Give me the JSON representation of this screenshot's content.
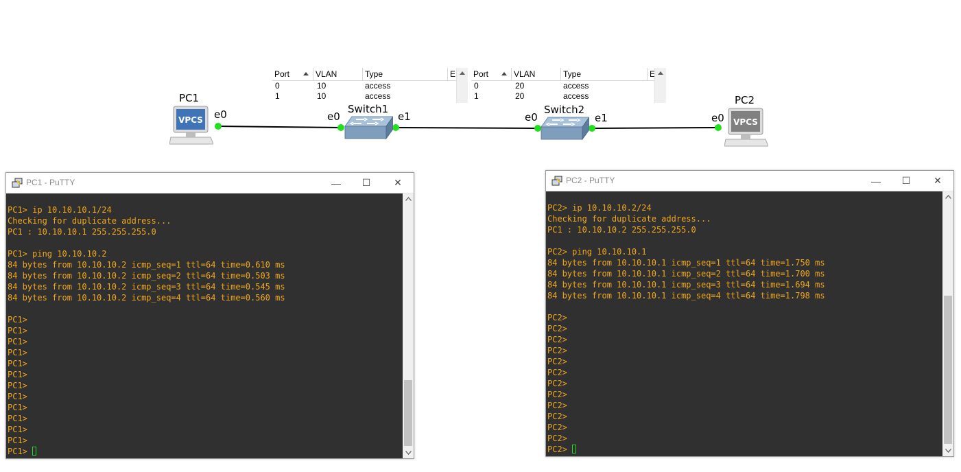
{
  "topology": {
    "nodes": {
      "pc1": {
        "name": "PC1",
        "icon": "vpcs-icon",
        "badge": "VPCS"
      },
      "switch1": {
        "name": "Switch1",
        "icon": "ethernet-switch-icon"
      },
      "switch2": {
        "name": "Switch2",
        "icon": "ethernet-switch-icon"
      },
      "pc2": {
        "name": "PC2",
        "icon": "vpcs-icon",
        "badge": "VPCS"
      }
    },
    "ports": {
      "pc1_e0": "e0",
      "sw1_e0": "e0",
      "sw1_e1": "e1",
      "sw2_e0": "e0",
      "sw2_e1": "e1",
      "pc2_e0": "e0"
    },
    "link_status_color": "#22e01e",
    "tables": [
      {
        "headers": [
          "Port",
          "VLAN",
          "Type",
          "E"
        ],
        "rows": [
          [
            "0",
            "10",
            "access"
          ],
          [
            "1",
            "10",
            "access"
          ]
        ]
      },
      {
        "headers": [
          "Port",
          "VLAN",
          "Type",
          "E"
        ],
        "rows": [
          [
            "0",
            "20",
            "access"
          ],
          [
            "1",
            "20",
            "access"
          ]
        ]
      }
    ]
  },
  "windows": [
    {
      "title": "PC1 - PuTTY",
      "icon": "putty-icon",
      "controls": {
        "minimize": "—",
        "maximize": "☐",
        "close": "✕"
      },
      "lines": [
        "",
        "PC1> ip 10.10.10.1/24",
        "Checking for duplicate address...",
        "PC1 : 10.10.10.1 255.255.255.0",
        "",
        "PC1> ping 10.10.10.2",
        "84 bytes from 10.10.10.2 icmp_seq=1 ttl=64 time=0.610 ms",
        "84 bytes from 10.10.10.2 icmp_seq=2 ttl=64 time=0.503 ms",
        "84 bytes from 10.10.10.2 icmp_seq=3 ttl=64 time=0.545 ms",
        "84 bytes from 10.10.10.2 icmp_seq=4 ttl=64 time=0.560 ms",
        "",
        "PC1>",
        "PC1>",
        "PC1>",
        "PC1>",
        "PC1>",
        "PC1>",
        "PC1>",
        "PC1>",
        "PC1>",
        "PC1>",
        "PC1>",
        "PC1>"
      ],
      "prompt": "PC1> ",
      "scroll_position": 0.85
    },
    {
      "title": "PC2 - PuTTY",
      "icon": "putty-icon",
      "controls": {
        "minimize": "—",
        "maximize": "☐",
        "close": "✕"
      },
      "lines": [
        "",
        "PC2> ip 10.10.10.2/24",
        "Checking for duplicate address...",
        "PC1 : 10.10.10.2 255.255.255.0",
        "",
        "PC2> ping 10.10.10.1",
        "84 bytes from 10.10.10.1 icmp_seq=1 ttl=64 time=1.750 ms",
        "84 bytes from 10.10.10.1 icmp_seq=2 ttl=64 time=1.700 ms",
        "84 bytes from 10.10.10.1 icmp_seq=3 ttl=64 time=1.694 ms",
        "84 bytes from 10.10.10.1 icmp_seq=4 ttl=64 time=1.798 ms",
        "",
        "PC2>",
        "PC2>",
        "PC2>",
        "PC2>",
        "PC2>",
        "PC2>",
        "PC2>",
        "PC2>",
        "PC2>",
        "PC2>",
        "PC2>",
        "PC2>"
      ],
      "prompt": "PC2> ",
      "scroll_position": 0.62
    }
  ]
}
